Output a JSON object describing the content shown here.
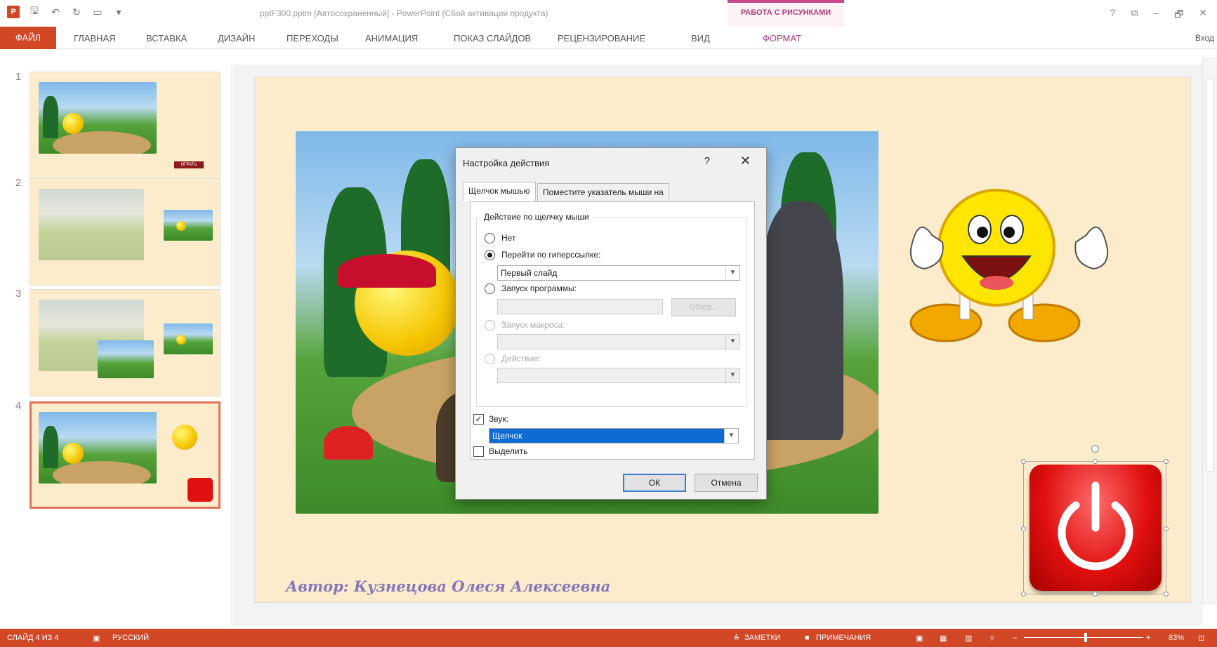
{
  "titlebar": {
    "doc_title": "pptF300.pptm [Автосохраненный] - PowerPoint (Сбой активации продукта)",
    "context_group": "РАБОТА С РИСУНКАМИ",
    "help": "?",
    "ribbon_display": "⧉",
    "minimize": "–",
    "restore": "🗗",
    "close": "✕"
  },
  "ribbon": {
    "tabs": [
      "ФАЙЛ",
      "ГЛАВНАЯ",
      "ВСТАВКА",
      "ДИЗАЙН",
      "ПЕРЕХОДЫ",
      "АНИМАЦИЯ",
      "ПОКАЗ СЛАЙДОВ",
      "РЕЦЕНЗИРОВАНИЕ",
      "ВИД",
      "ФОРМАТ"
    ],
    "signin": "Вход"
  },
  "thumbnails": {
    "numbers": [
      "1",
      "2",
      "3",
      "4"
    ],
    "slide1_button": "ИГРАТЬ"
  },
  "slide": {
    "author": "Автор: Кузнецова Олеся Алексеевна"
  },
  "dialog": {
    "title": "Настройка действия",
    "help": "?",
    "close": "✕",
    "tab_click": "Щелчок мышью",
    "tab_hover": "Поместите указатель мыши на",
    "group_label": "Действие по щелчку мыши",
    "opt_none": "Нет",
    "opt_hyperlink": "Перейти по гиперссылке:",
    "hyperlink_value": "Первый слайд",
    "opt_program": "Запуск программы:",
    "browse": "Обзор...",
    "opt_macro": "Запуск макроса:",
    "opt_action": "Действие:",
    "sound_label": "Звук:",
    "sound_value": "Щелчок",
    "highlight_label": "Выделить",
    "ok": "ОК",
    "cancel": "Отмена"
  },
  "status": {
    "slide_counter": "СЛАЙД 4 ИЗ 4",
    "language": "РУССКИЙ",
    "notes": "ЗАМЕТКИ",
    "comments": "ПРИМЕЧАНИЯ",
    "zoom": "83%"
  }
}
